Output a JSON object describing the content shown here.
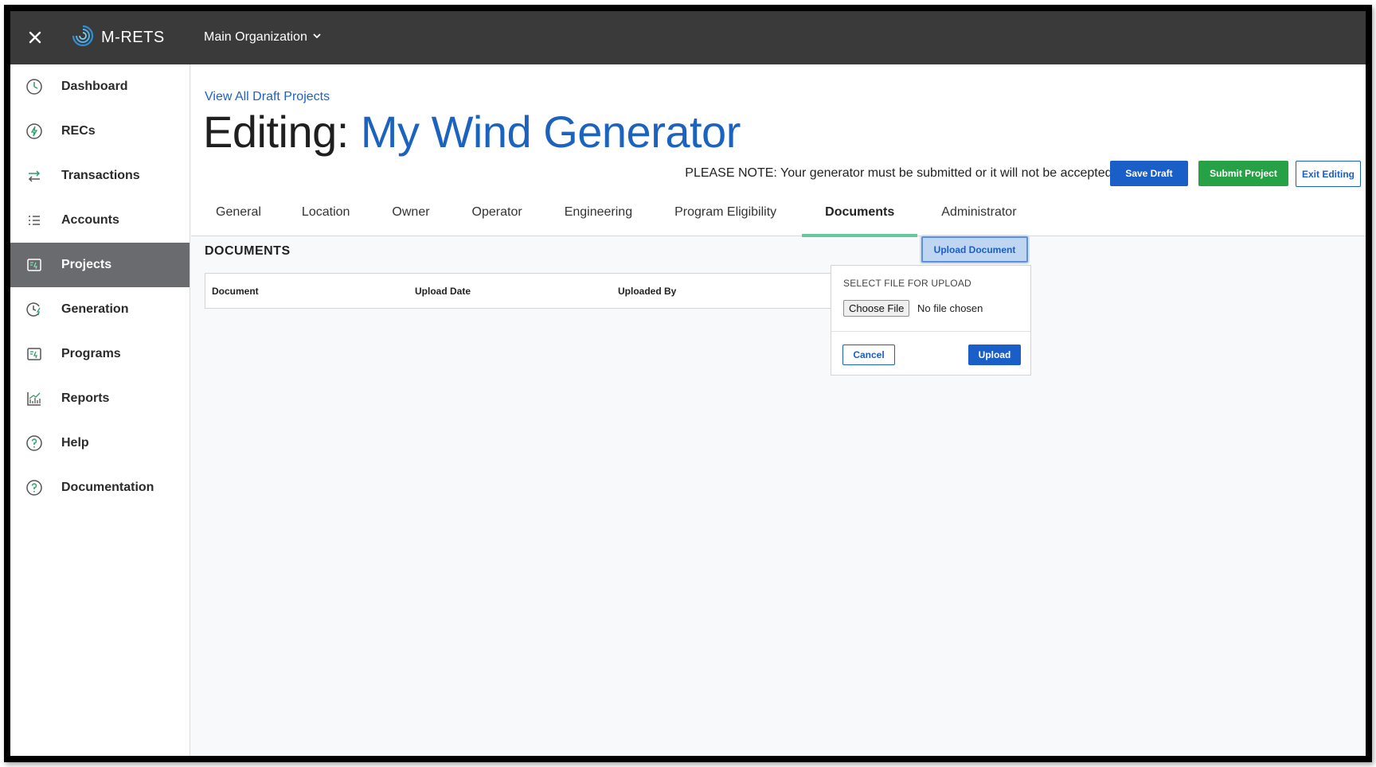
{
  "app": {
    "brand": "M-RETS",
    "organization": "Main Organization"
  },
  "sidebar": {
    "items": [
      {
        "label": "Dashboard",
        "icon": "clock-dial-icon"
      },
      {
        "label": "RECs",
        "icon": "lightning-circle-icon"
      },
      {
        "label": "Transactions",
        "icon": "arrows-swap-icon"
      },
      {
        "label": "Accounts",
        "icon": "list-icon"
      },
      {
        "label": "Projects",
        "icon": "project-card-icon"
      },
      {
        "label": "Generation",
        "icon": "clock-lightning-icon"
      },
      {
        "label": "Programs",
        "icon": "program-card-icon"
      },
      {
        "label": "Reports",
        "icon": "bar-chart-icon"
      },
      {
        "label": "Help",
        "icon": "question-circle-icon"
      },
      {
        "label": "Documentation",
        "icon": "question-circle-icon"
      }
    ],
    "active": "Projects"
  },
  "header": {
    "back_link": "View All Draft Projects",
    "title_prefix": "Editing:",
    "project_name": "My Wind Generator",
    "note": "PLEASE NOTE: Your generator must be submitted or it will not be accepted.",
    "save_draft": "Save Draft",
    "submit_project": "Submit Project",
    "exit_editing": "Exit Editing"
  },
  "tabs": [
    {
      "label": "General"
    },
    {
      "label": "Location"
    },
    {
      "label": "Owner"
    },
    {
      "label": "Operator"
    },
    {
      "label": "Engineering"
    },
    {
      "label": "Program Eligibility"
    },
    {
      "label": "Documents"
    },
    {
      "label": "Administrator"
    }
  ],
  "active_tab": "Documents",
  "documents": {
    "section_title": "DOCUMENTS",
    "upload_document": "Upload Document",
    "columns": [
      "Document",
      "Upload Date",
      "Uploaded By"
    ]
  },
  "upload_popover": {
    "title": "SELECT FILE FOR UPLOAD",
    "choose_file": "Choose File",
    "no_file": "No file chosen",
    "cancel": "Cancel",
    "upload": "Upload"
  },
  "colors": {
    "topbar": "#3a3a3a",
    "primary": "#1a5ec8",
    "success": "#27a146",
    "tab_underline": "#65c99a",
    "sidebar_active": "#696b6e"
  }
}
